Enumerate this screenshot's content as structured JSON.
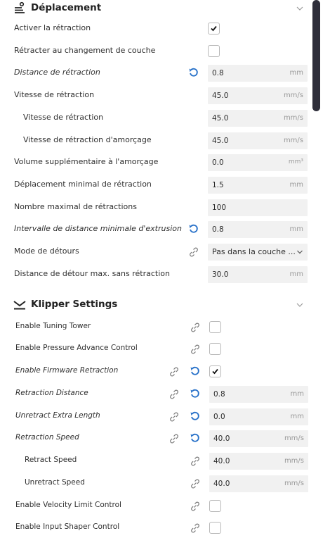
{
  "deplacement": {
    "title": "Déplacement",
    "rows": [
      {
        "label": "Activer la rétraction",
        "checked": true
      },
      {
        "label": "Rétracter au changement de couche",
        "checked": false
      },
      {
        "label": "Distance de rétraction",
        "value": "0.8",
        "unit": "mm"
      },
      {
        "label": "Vitesse de rétraction",
        "value": "45.0",
        "unit": "mm/s"
      },
      {
        "label": "Vitesse de rétraction",
        "value": "45.0",
        "unit": "mm/s"
      },
      {
        "label": "Vitesse de rétraction d'amorçage",
        "value": "45.0",
        "unit": "mm/s"
      },
      {
        "label": "Volume supplémentaire à l'amorçage",
        "value": "0.0",
        "unit": "mm³"
      },
      {
        "label": "Déplacement minimal de rétraction",
        "value": "1.5",
        "unit": "mm"
      },
      {
        "label": "Nombre maximal de rétractions",
        "value": "100"
      },
      {
        "label": "Intervalle de distance minimale d'extrusion",
        "value": "0.8",
        "unit": "mm"
      },
      {
        "label": "Mode de détours",
        "value": "Pas dans la couche ..."
      },
      {
        "label": "Distance de détour max. sans rétraction",
        "value": "30.0",
        "unit": "mm"
      }
    ]
  },
  "klipper": {
    "title": "Klipper Settings",
    "rows": [
      {
        "label": "Enable Tuning Tower",
        "checked": false
      },
      {
        "label": "Enable Pressure Advance Control",
        "checked": false
      },
      {
        "label": "Enable Firmware Retraction",
        "checked": true
      },
      {
        "label": "Retraction Distance",
        "value": "0.8",
        "unit": "mm"
      },
      {
        "label": "Unretract Extra Length",
        "value": "0.0",
        "unit": "mm"
      },
      {
        "label": "Retraction Speed",
        "value": "40.0",
        "unit": "mm/s"
      },
      {
        "label": "Retract Speed",
        "value": "40.0",
        "unit": "mm/s"
      },
      {
        "label": "Unretract Speed",
        "value": "40.0",
        "unit": "mm/s"
      },
      {
        "label": "Enable Velocity Limit Control",
        "checked": false
      },
      {
        "label": "Enable Input Shaper Control",
        "checked": false
      }
    ]
  },
  "colors": {
    "accent": "#2670c8",
    "field_bg": "#f1f1f1",
    "scrollbar": "#2e2e3a"
  },
  "icons": {
    "reset": "reset-icon",
    "link": "link-icon",
    "collapse": "chevron-down-icon"
  }
}
